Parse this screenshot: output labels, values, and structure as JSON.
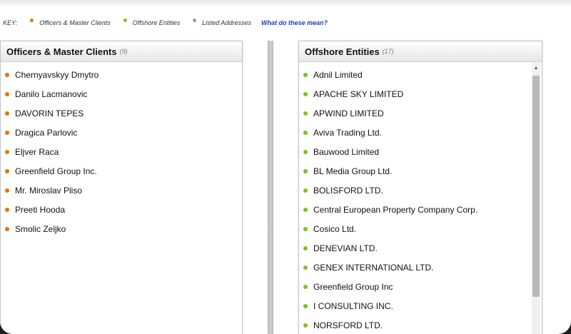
{
  "key": {
    "label": "KEY:",
    "items": [
      {
        "label": "Officers & Master Clients",
        "color": "#e8740c"
      },
      {
        "label": "Offshore Entities",
        "color": "#7cc21f"
      },
      {
        "label": "Listed Addresses",
        "color": "#9a9a9a"
      }
    ],
    "link": "What do these mean?"
  },
  "officers": {
    "title": "Officers & Master Clients",
    "count": "(9)",
    "items": [
      "Chernyavskyy Dmytro",
      "Danilo Lacmanovic",
      "DAVORIN TEPES",
      "Dragica Parlovic",
      "Eljver Raca",
      "Greenfield Group Inc.",
      "Mr. Miroslav Pliso",
      "Preeti Hooda",
      "Smolic Zeljko"
    ]
  },
  "entities": {
    "title": "Offshore Entities",
    "count": "(17)",
    "items": [
      "Adnil Limited",
      "APACHE SKY LIMITED",
      "APWIND LIMITED",
      "Aviva Trading Ltd.",
      "Bauwood Limited",
      "BL Media Group Ltd.",
      "BOLISFORD LTD.",
      "Central European Property Company Corp.",
      "Cosico Ltd.",
      "DENEVIAN LTD.",
      "GENEX INTERNATIONAL LTD.",
      "Greenfield Group Inc",
      "I CONSULTING INC.",
      "NORSFORD LTD."
    ]
  }
}
